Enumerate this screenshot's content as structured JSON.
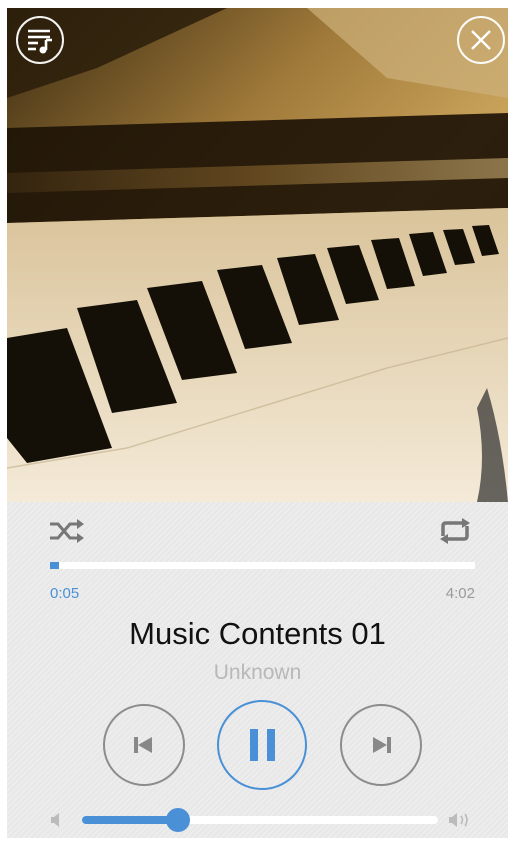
{
  "player": {
    "album_art": "piano-keys-photo",
    "buttons": {
      "playlist_icon": "playlist-music-icon",
      "close_icon": "close-icon",
      "shuffle_icon": "shuffle-icon",
      "repeat_icon": "repeat-icon",
      "prev_icon": "skip-previous-icon",
      "pause_icon": "pause-icon",
      "next_icon": "skip-next-icon",
      "volume_low_icon": "volume-low-icon",
      "volume_high_icon": "volume-high-icon"
    },
    "progress": {
      "elapsed": "0:05",
      "total": "4:02",
      "fraction": 0.02
    },
    "track": {
      "title": "Music Contents 01",
      "artist": "Unknown"
    },
    "volume": {
      "level": 0.27
    },
    "colors": {
      "accent": "#4a90d6",
      "panel": "#e8e8e8",
      "muted_text": "#b8b8b8",
      "icon_gray": "#777777"
    }
  }
}
